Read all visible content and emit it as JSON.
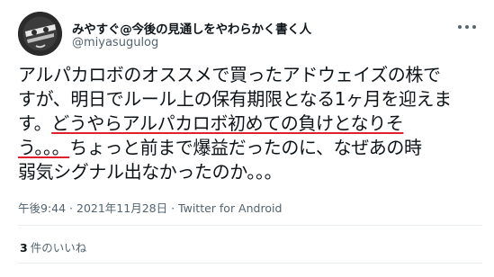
{
  "tweet": {
    "author": {
      "display_name": "みやすぐ@今後の見通しをやわらかく書く人",
      "handle": "@miyasugulog",
      "avatar_icon": "profile-avatar-icon"
    },
    "more_icon": "more-options-icon",
    "text_lines": [
      {
        "before": "アルパカロボのオススメで買ったアドウェイズの株で",
        "underlined": "",
        "after": ""
      },
      {
        "before": "すが、明日でルール上の保有期限となる1ヶ月を迎えま",
        "underlined": "",
        "after": ""
      },
      {
        "before": "す。",
        "underlined": "どうやらアルパカロボ初めての負けとなりそ",
        "after": ""
      },
      {
        "before": "",
        "underlined": "う。。。",
        "after": "ちょっと前まで爆益だったのに、なぜあの時"
      },
      {
        "before": "弱気シグナル出なかったのか。。。",
        "underlined": "",
        "after": ""
      }
    ],
    "timestamp": "午後9:44 · 2021年11月28日 · Twitter for Android",
    "likes": {
      "count": "3",
      "label": "件のいいね"
    },
    "colors": {
      "text": "#0f1419",
      "secondary": "#536471",
      "underline": "#e0202b",
      "divider": "#e6ecf0"
    }
  }
}
